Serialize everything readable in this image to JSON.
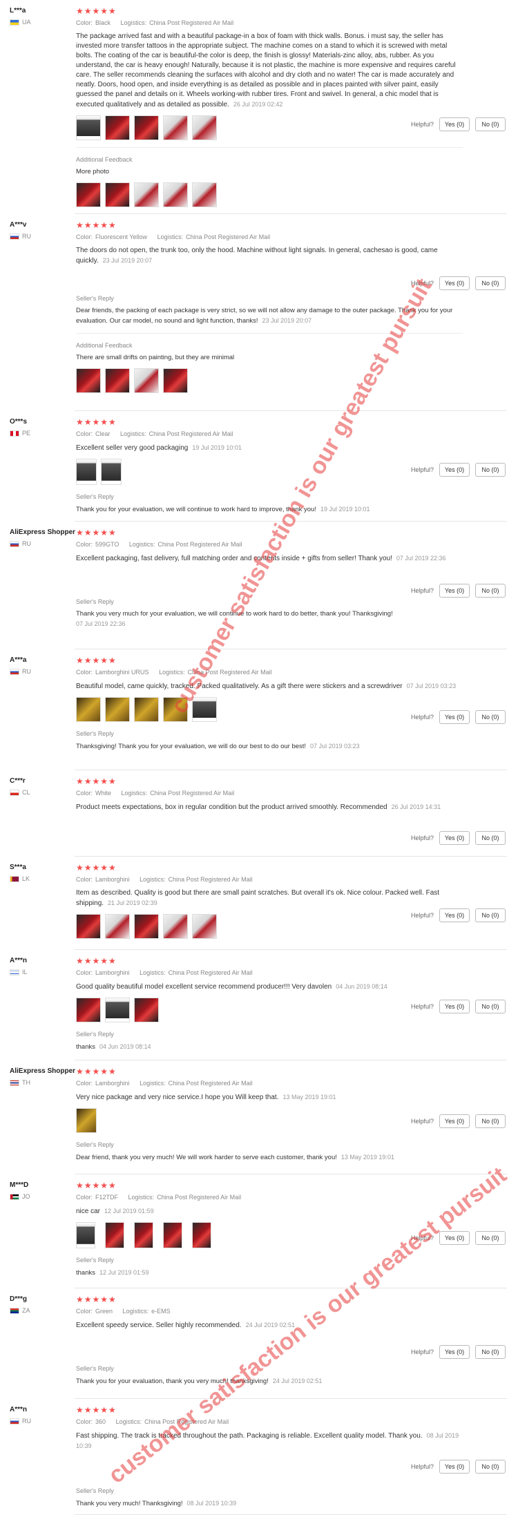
{
  "labels": {
    "color": "Color:",
    "logistics": "Logistics:",
    "helpful": "Helpful?",
    "yes": "Yes (0)",
    "no": "No (0)",
    "sellers_reply": "Seller's Reply",
    "additional_feedback": "Additional Feedback",
    "stars": "★★★★★"
  },
  "watermark": "customer satisfaction is our greatest pursuit",
  "reviews": [
    {
      "user": "L***a",
      "country": "UA",
      "color": "Black",
      "logistics": "China Post Registered Air Mail",
      "text": "The package arrived fast and with a beautiful package-in a box of foam with thick walls. Bonus. i must say, the seller has invested more transfer tattoos in the appropriate subject. The machine comes on a stand to which it is screwed with metal bolts. The coating of the car is beautiful-the color is deep, the finish is glossy! Materials-zinc alloy, abs, rubber. As you understand, the car is heavy enough! Naturally, because it is not plastic, the machine is more expensive and requires careful care. The seller recommends cleaning the surfaces with alcohol and dry cloth and no water! The car is made accurately and neatly. Doors, hood open, and inside everything is as detailed as possible and in places painted with silver paint, easily guessed the panel and details on it. Wheels working-with rubber tires. Front and swivel. In general, a chic model that is executed qualitatively and as detailed as possible.",
      "date": "26 Jul 2019 02:42",
      "additional": "More photo"
    },
    {
      "user": "A***v",
      "country": "RU",
      "color": "Fluorescent Yellow",
      "logistics": "China Post Registered Air Mail",
      "text": "The doors do not open, the trunk too, only the hood. Machine without light signals. In general, cachesao is good, came quickly.",
      "date": "23 Jul 2019 20:07",
      "reply": "Dear friends, the packing of each package is very strict, so we will not allow any damage to the outer package. Thank you for your evaluation. Our car model, no sound and light function, thanks!",
      "reply_date": "23 Jul 2019 20:07",
      "additional": "There are small drifts on painting, but they are minimal"
    },
    {
      "user": "O***s",
      "country": "PE",
      "color": "Clear",
      "logistics": "China Post Registered Air Mail",
      "text": "Excellent seller very good packaging",
      "date": "19 Jul 2019 10:01",
      "reply": "Thank you for your evaluation, we will continue to work hard to improve, thank you!",
      "reply_date": "19 Jul 2019 10:01"
    },
    {
      "user": "AliExpress Shopper",
      "country": "RU",
      "color": "599GTO",
      "logistics": "China Post Registered Air Mail",
      "text": "Excellent packaging, fast delivery, full matching order and contents inside + gifts from seller! Thank you!",
      "date": "07 Jul 2019 22:36",
      "reply": "Thank you very much for your evaluation, we will continue to work hard to do better, thank you! Thanksgiving!",
      "reply_date": "07 Jul 2019 22:36"
    },
    {
      "user": "A***a",
      "country": "RU",
      "color": "Lamborghini URUS",
      "logistics": "China Post Registered Air Mail",
      "text": "Beautiful model, came quickly, tracked. Packed qualitatively. As a gift there were stickers and a screwdriver",
      "date": "07 Jul 2019 03:23",
      "reply": "Thanksgiving! Thank you for your evaluation, we will do our best to do our best!",
      "reply_date": "07 Jul 2019 03:23"
    },
    {
      "user": "C***r",
      "country": "CL",
      "color": "White",
      "logistics": "China Post Registered Air Mail",
      "text": "Product meets expectations, box in regular condition but the product arrived smoothly. Recommended",
      "date": "26 Jul 2019 14:31"
    },
    {
      "user": "S***a",
      "country": "LK",
      "color": "Lamborghini",
      "logistics": "China Post Registered Air Mail",
      "text": "Item as described. Quality is good but there are small paint scratches. But overall it's ok. Nice colour. Packed well. Fast shipping.",
      "date": "21 Jul 2019 02:39"
    },
    {
      "user": "A***n",
      "country": "IL",
      "color": "Lamborghini",
      "logistics": "China Post Registered Air Mail",
      "text": "Good quality beautiful model excellent service recommend producer!!! Very davolen",
      "date": "04 Jun 2019 08:14",
      "reply": "thanks",
      "reply_date": "04 Jun 2019 08:14"
    },
    {
      "user": "AliExpress Shopper",
      "country": "TH",
      "color": "Lamborghini",
      "logistics": "China Post Registered Air Mail",
      "text": "Very nice package and very nice service.I hope you Will keep that.",
      "date": "13 May 2019 19:01",
      "reply": "Dear friend, thank you very much! We will work harder to serve each customer, thank you!",
      "reply_date": "13 May 2019 19:01"
    },
    {
      "user": "M***D",
      "country": "JO",
      "color": "F12TDF",
      "logistics": "China Post Registered Air Mail",
      "text": "nice car",
      "date": "12 Jul 2019 01:59",
      "reply": "thanks",
      "reply_date": "12 Jul 2019 01:59"
    },
    {
      "user": "D***g",
      "country": "ZA",
      "color": "Green",
      "logistics": "e-EMS",
      "text": "Excellent speedy service. Seller highly recommended.",
      "date": "24 Jul 2019 02:51",
      "reply": "Thank you for your evaluation, thank you very much! thanksgiving!",
      "reply_date": "24 Jul 2019 02:51"
    },
    {
      "user": "A***n",
      "country": "RU",
      "color": "360",
      "logistics": "China Post Registered Air Mail",
      "text": "Fast shipping. The track is tracked throughout the path. Packaging is reliable. Excellent quality model. Thank you.",
      "date": "08 Jul 2019 10:39",
      "reply": "Thank you very much! Thanksgiving!",
      "reply_date": "08 Jul 2019 10:39"
    }
  ]
}
